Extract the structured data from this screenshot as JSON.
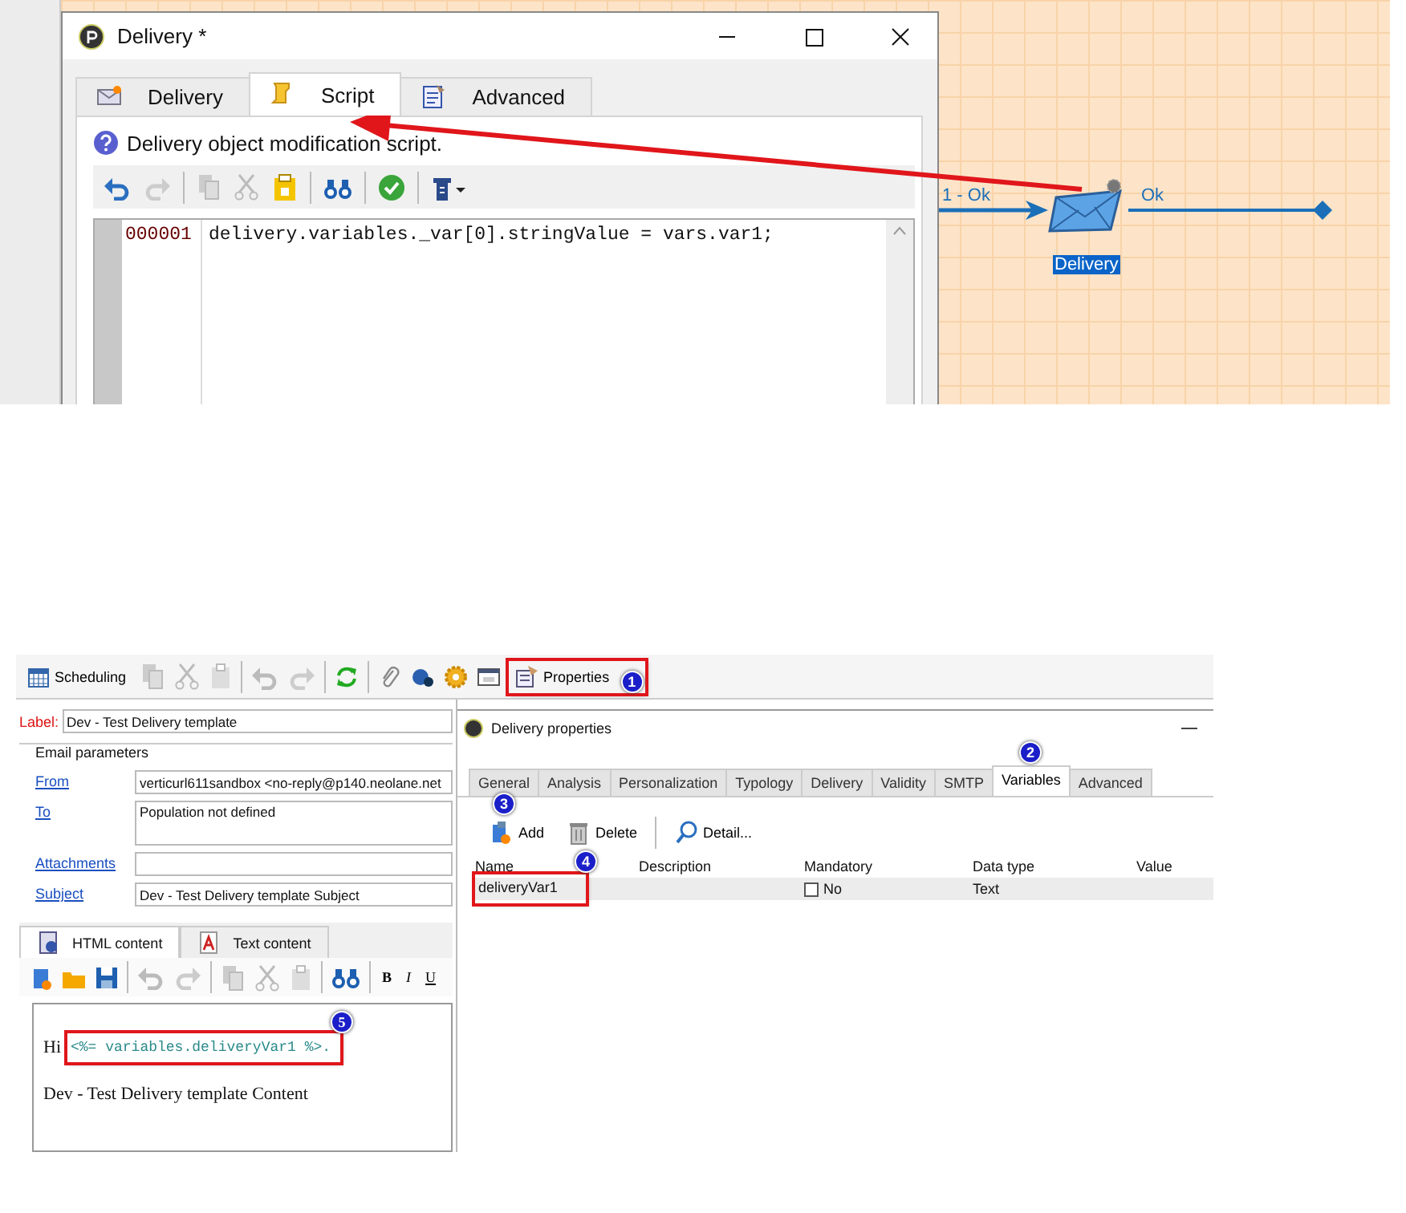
{
  "script_dialog": {
    "title": "Delivery *",
    "tabs": [
      {
        "label": "Delivery",
        "selected": false,
        "kind": "envelope"
      },
      {
        "label": "Script",
        "selected": true,
        "kind": "scroll"
      },
      {
        "label": "Advanced",
        "selected": false,
        "kind": "document"
      }
    ],
    "description": "Delivery object modification script.",
    "editor": {
      "lines": [
        {
          "number": "000001",
          "code": "delivery.variables._var[0].stringValue = vars.var1;"
        }
      ]
    }
  },
  "workflow": {
    "edges": [
      {
        "label": "1 - Ok",
        "kind": "incoming"
      },
      {
        "label": "Ok",
        "kind": "outgoing"
      }
    ],
    "node": {
      "label": "Delivery",
      "selected": true
    }
  },
  "delivery_form": {
    "toolbar": {
      "scheduling": "Scheduling",
      "properties": {
        "label": "Properties",
        "highlighted": true,
        "callout": "1"
      }
    },
    "label": {
      "caption": "Label:",
      "value": "Dev - Test Delivery template"
    },
    "email_parameters": {
      "title": "Email parameters",
      "fields": [
        {
          "label": "From",
          "value": "verticurl611sandbox <no-reply@p140.neolane.net",
          "kind": "line"
        },
        {
          "label": "To",
          "value": "Population not defined",
          "kind": "area"
        },
        {
          "label": "Attachments",
          "kind": "line"
        },
        {
          "label": "Subject",
          "value": "Dev - Test Delivery template Subject",
          "kind": "line"
        }
      ]
    },
    "content_tabs": [
      {
        "label": "HTML content",
        "selected": true,
        "kind": "html"
      },
      {
        "label": "Text content",
        "selected": false,
        "kind": "text"
      }
    ],
    "format_buttons": [
      "B",
      "I",
      "U"
    ],
    "content": {
      "greeting": "Hi",
      "expression": "<%= variables.deliveryVar1 %>.",
      "highlighted": true,
      "callout": "5",
      "body": "Dev - Test Delivery template Content"
    }
  },
  "properties_window": {
    "title": "Delivery properties",
    "tabs": [
      {
        "label": "General",
        "selected": false
      },
      {
        "label": "Analysis",
        "selected": false
      },
      {
        "label": "Personalization",
        "selected": false
      },
      {
        "label": "Typology",
        "selected": false
      },
      {
        "label": "Delivery",
        "selected": false
      },
      {
        "label": "Validity",
        "selected": false
      },
      {
        "label": "SMTP",
        "selected": false
      },
      {
        "label": "Variables",
        "selected": true,
        "callout": "2"
      },
      {
        "label": "Advanced",
        "selected": false
      }
    ],
    "toolbar": [
      {
        "label": "Add",
        "kind": "add",
        "callout": "3"
      },
      {
        "label": "Delete",
        "kind": "delete"
      },
      {
        "label": "Detail...",
        "kind": "detail"
      }
    ],
    "columns": [
      "Name",
      "Description",
      "Mandatory",
      "Data type",
      "Value"
    ],
    "rows": [
      {
        "name": "deliveryVar1",
        "highlighted": true,
        "callout": "4",
        "selected": true,
        "mandatory": false,
        "mandatory_label": "No",
        "data_type": "Text"
      }
    ]
  }
}
